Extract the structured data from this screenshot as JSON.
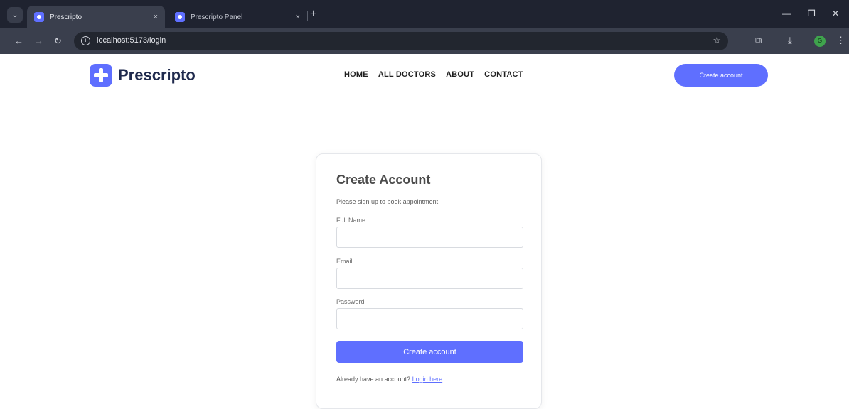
{
  "browser": {
    "tabs": [
      {
        "title": "Prescripto",
        "close": "×"
      },
      {
        "title": "Prescripto Panel",
        "close": "×"
      }
    ],
    "new_tab": "+",
    "url": "localhost:5173/login",
    "profile_initial": "G"
  },
  "site": {
    "brand": "Prescripto",
    "nav": [
      "HOME",
      "ALL DOCTORS",
      "ABOUT",
      "CONTACT"
    ],
    "header_button": "Create account",
    "accent_color": "#5f6fff"
  },
  "form": {
    "title": "Create Account",
    "subtitle": "Please sign up to book appointment",
    "fields": [
      {
        "label": "Full Name",
        "value": ""
      },
      {
        "label": "Email",
        "value": ""
      },
      {
        "label": "Password",
        "value": ""
      }
    ],
    "submit_label": "Create account",
    "footer_text": "Already have an account?",
    "footer_link": "Login here"
  }
}
